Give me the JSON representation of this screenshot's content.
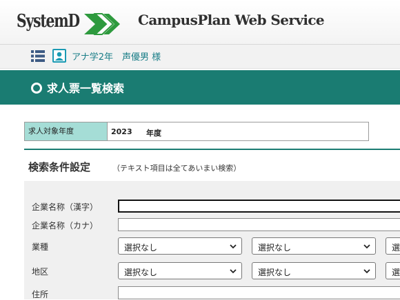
{
  "header": {
    "logo_text": "SystemD",
    "app_title": "CampusPlan Web Service"
  },
  "userbar": {
    "user_name": "アナ学2年　声優男 様"
  },
  "page": {
    "title": "求人票一覧検索"
  },
  "year_row": {
    "label": "求人対象年度",
    "value": "2023",
    "suffix": "年度"
  },
  "section": {
    "title": "検索条件設定",
    "note": "（テキスト項目は全てあいまい検索）"
  },
  "form": {
    "company_kanji": {
      "label": "企業名称（漢字）",
      "value": ""
    },
    "company_kana": {
      "label": "企業名称（カナ）",
      "value": ""
    },
    "industry": {
      "label": "業種",
      "select1": "選択なし",
      "select2": "選択なし",
      "select3": "選"
    },
    "region": {
      "label": "地区",
      "select1": "選択なし",
      "select2": "選択なし",
      "select3": "選"
    },
    "address": {
      "label": "住所",
      "value": ""
    }
  },
  "colors": {
    "accent": "#1a7c72",
    "year_label_bg": "#a5ddd6",
    "user_text": "#1b7e88",
    "logo_green": "#2e9a3e"
  },
  "icons": [
    "list-menu-icon",
    "user-icon",
    "circle-bullet-icon",
    "chevron-down-icon"
  ]
}
